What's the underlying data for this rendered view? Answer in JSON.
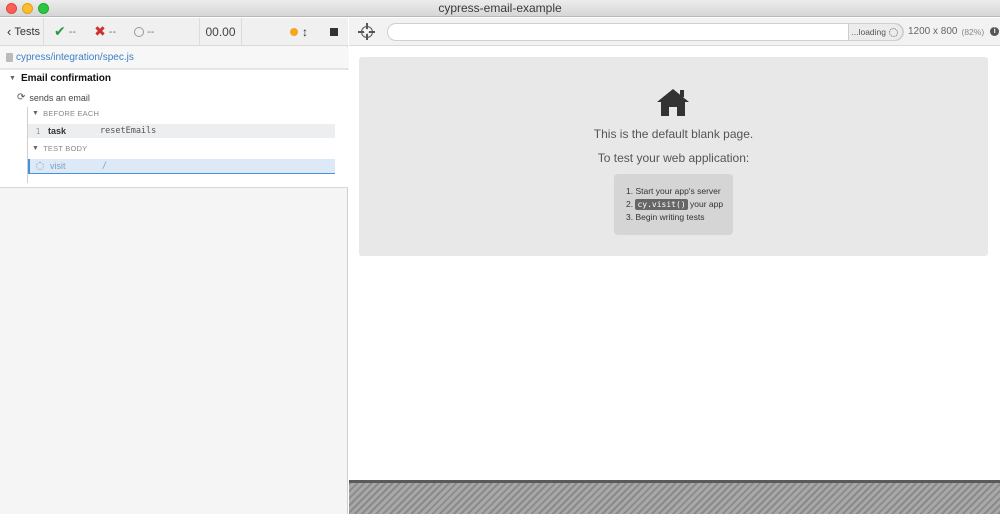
{
  "window": {
    "title": "cypress-email-example"
  },
  "reporter": {
    "tests_label": "Tests",
    "stats": {
      "passed": "--",
      "failed": "--",
      "pending": "--"
    },
    "duration": "00.00",
    "spec_path": "cypress/integration/spec.js",
    "suite": {
      "title": "Email confirmation",
      "test": {
        "title": "sends an email",
        "hooks": [
          {
            "title": "BEFORE EACH",
            "commands": [
              {
                "number": "1",
                "name": "task",
                "message": "resetEmails"
              }
            ]
          },
          {
            "title": "TEST BODY",
            "commands": [
              {
                "number": "",
                "name": "visit",
                "message": "/"
              }
            ]
          }
        ]
      }
    },
    "colors": {
      "passed": "#2b9a3e",
      "failed": "#d0302d",
      "running": "#f5a623",
      "active": "#4a90d9"
    }
  },
  "runner": {
    "url": "",
    "loading_label": "...loading",
    "viewport": "1200 x 800",
    "scale": "(82%)",
    "blank_page": {
      "message": "This is the default blank page.",
      "sub_message": "To test your web application:",
      "steps": [
        {
          "prefix": "1.",
          "text": "Start your app's server"
        },
        {
          "prefix": "2.",
          "code": "cy.visit()",
          "text": "your app"
        },
        {
          "prefix": "3.",
          "text": "Begin writing tests"
        }
      ]
    }
  }
}
